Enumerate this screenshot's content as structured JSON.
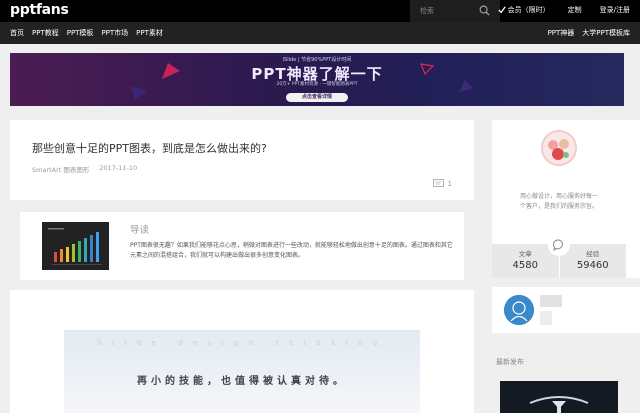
{
  "site": {
    "logo": "pptfans"
  },
  "search": {
    "placeholder": "检索"
  },
  "top_links": {
    "vip": "会员（限时）",
    "custom": "定制",
    "auth": "登录/注册"
  },
  "nav": {
    "left": [
      "首页",
      "PPT教程",
      "PPT模板",
      "PPT市场",
      "PPT素材"
    ],
    "right": [
      "PPT神器",
      "大学PPT模板库"
    ]
  },
  "banner": {
    "sub": "iSlide | 节省90%PPT设计时间",
    "title": "PPT神器了解一下",
    "line": "20万+ PPT素材资源 · 一键智能图表PPT",
    "cta": "点击查看详情"
  },
  "article": {
    "title": "那些创意十足的PPT图表，到底是怎么做出来的?",
    "category": "SmartArt 图表图形",
    "date": "2017-11-10",
    "comment_count": "1"
  },
  "summary": {
    "heading": "导读",
    "text": "PPT图表很无趣？如果我们能够花点心思，稍微对图表进行一些改动，就能够轻松地做出创意十足的图表。通过图表和其它元素之间的混搭组合，我们就可以构建出做出很多创意变化图表。"
  },
  "content_image": {
    "en_text": "Slide design thinking",
    "cn_text": "再小的技能，也值得被认真对待。"
  },
  "profile": {
    "bio_line1": "用心做设计，用心服务好每一",
    "bio_line2": "个客户，是我们的服务宗旨。",
    "stats": [
      {
        "label": "文章",
        "value": "4580"
      },
      {
        "label": "经验",
        "value": "59460"
      }
    ]
  },
  "sidebar": {
    "recent_heading": "最新发布"
  },
  "colors": {
    "topbar": "#000000",
    "navbar": "#222222",
    "page_bg": "#efefef",
    "banner_start": "#4c1c54",
    "banner_end": "#26285e"
  }
}
